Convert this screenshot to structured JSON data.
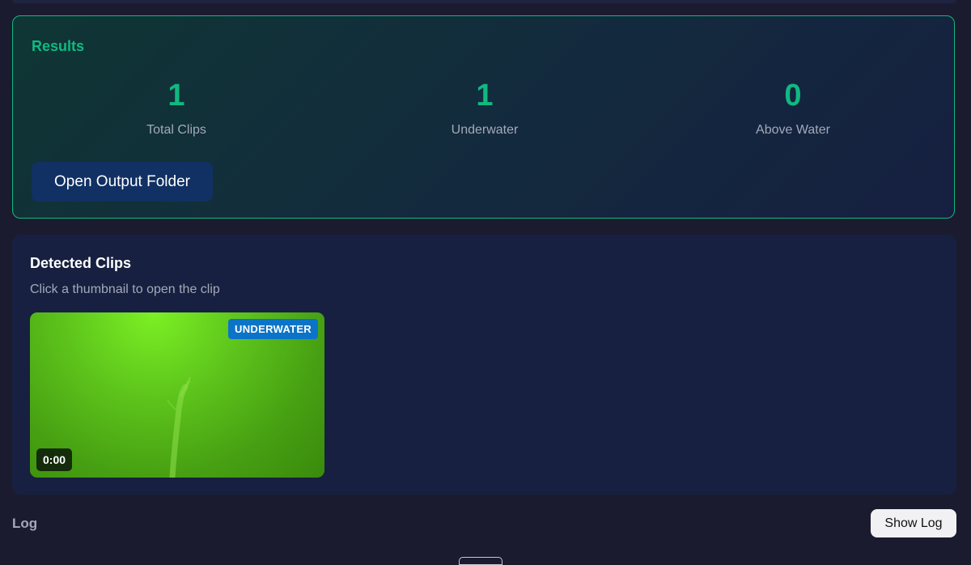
{
  "results": {
    "title": "Results",
    "stats": [
      {
        "value": "1",
        "label": "Total Clips"
      },
      {
        "value": "1",
        "label": "Underwater"
      },
      {
        "value": "0",
        "label": "Above Water"
      }
    ],
    "open_folder_label": "Open Output Folder"
  },
  "clips": {
    "title": "Detected Clips",
    "subtitle": "Click a thumbnail to open the clip",
    "items": [
      {
        "badge": "UNDERWATER",
        "duration": "0:00"
      }
    ]
  },
  "log": {
    "label": "Log",
    "show_log_label": "Show Log"
  },
  "colors": {
    "accent": "#10b981",
    "badge": "#0b74c8",
    "button_primary": "#113063"
  }
}
